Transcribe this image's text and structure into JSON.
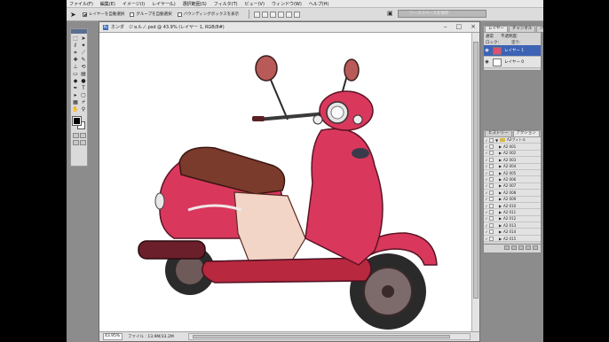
{
  "menu": [
    "ファイル(F)",
    "編集(E)",
    "イメージ(I)",
    "レイヤー(L)",
    "選択範囲(S)",
    "フィルタ(T)",
    "ビュー(V)",
    "ウィンドウ(W)",
    "ヘルプ(H)"
  ],
  "options": {
    "tool_icon": "move-tool-icon",
    "auto_select_layer": "レイヤーを自動選択",
    "auto_select_group": "グループを自動選択",
    "show_bounding_box": "バウンディングボックスを表示",
    "workspace_label": "ワークスペースを保存"
  },
  "document": {
    "title": "ホンダ　ジョルノ.psd @ 43.9% (レイヤー 1, RGB/8#)",
    "zoom": "43.95%",
    "file_info": "ファイル : 13.9M/33.2M"
  },
  "layers_panel": {
    "tabs": [
      "レイヤー",
      "チャンネル",
      "パス"
    ],
    "blend_mode": "通常",
    "opacity_label": "不透明度:",
    "lock_label": "ロック:",
    "fill_label": "塗り:",
    "layers": [
      {
        "name": "レイヤー 1",
        "selected": true,
        "thumb": "scooter"
      },
      {
        "name": "レイヤー 0",
        "selected": false,
        "thumb": "blank"
      }
    ]
  },
  "actions_panel": {
    "tabs": [
      "ヒストリー",
      "アクション"
    ],
    "set_name": "A2ヴィトル",
    "actions": [
      "A2 001",
      "A2 002",
      "A2 003",
      "A2 004",
      "A2 005",
      "A2 006",
      "A2 007",
      "A2 008",
      "A2 009",
      "A2 010",
      "A2 011",
      "A2 012",
      "A2 013",
      "A2 014",
      "A2 015"
    ]
  },
  "colors": {
    "scooter_body": "#d9385c",
    "seat": "#7a3a2c",
    "panel_selected": "#3d63b5"
  }
}
